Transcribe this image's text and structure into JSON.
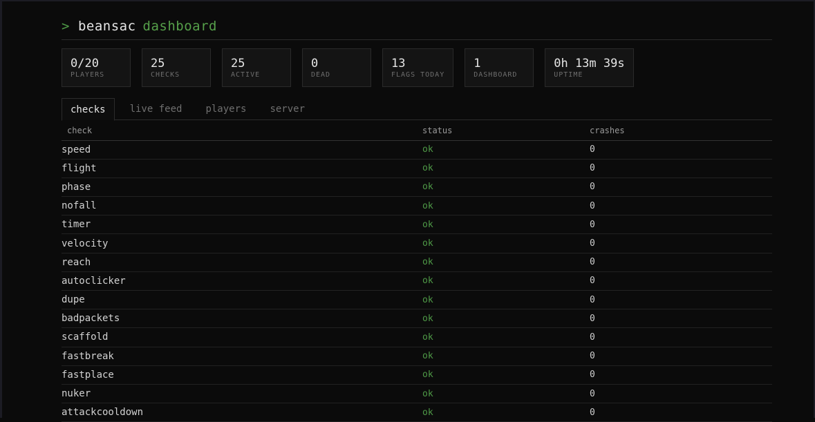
{
  "header": {
    "prompt": ">",
    "name": "beansac",
    "subtitle": "dashboard"
  },
  "stats": [
    {
      "value": "0/20",
      "label": "PLAYERS"
    },
    {
      "value": "25",
      "label": "CHECKS"
    },
    {
      "value": "25",
      "label": "ACTIVE"
    },
    {
      "value": "0",
      "label": "DEAD"
    },
    {
      "value": "13",
      "label": "FLAGS TODAY"
    },
    {
      "value": "1",
      "label": "DASHBOARD"
    },
    {
      "value": "0h 13m 39s",
      "label": "UPTIME"
    }
  ],
  "tabs": [
    {
      "label": "checks",
      "active": true
    },
    {
      "label": "live feed",
      "active": false
    },
    {
      "label": "players",
      "active": false
    },
    {
      "label": "server",
      "active": false
    }
  ],
  "table": {
    "columns": [
      "check",
      "status",
      "crashes"
    ],
    "rows": [
      {
        "check": "speed",
        "status": "ok",
        "crashes": "0"
      },
      {
        "check": "flight",
        "status": "ok",
        "crashes": "0"
      },
      {
        "check": "phase",
        "status": "ok",
        "crashes": "0"
      },
      {
        "check": "nofall",
        "status": "ok",
        "crashes": "0"
      },
      {
        "check": "timer",
        "status": "ok",
        "crashes": "0"
      },
      {
        "check": "velocity",
        "status": "ok",
        "crashes": "0"
      },
      {
        "check": "reach",
        "status": "ok",
        "crashes": "0"
      },
      {
        "check": "autoclicker",
        "status": "ok",
        "crashes": "0"
      },
      {
        "check": "dupe",
        "status": "ok",
        "crashes": "0"
      },
      {
        "check": "badpackets",
        "status": "ok",
        "crashes": "0"
      },
      {
        "check": "scaffold",
        "status": "ok",
        "crashes": "0"
      },
      {
        "check": "fastbreak",
        "status": "ok",
        "crashes": "0"
      },
      {
        "check": "fastplace",
        "status": "ok",
        "crashes": "0"
      },
      {
        "check": "nuker",
        "status": "ok",
        "crashes": "0"
      },
      {
        "check": "attackcooldown",
        "status": "ok",
        "crashes": "0"
      }
    ]
  },
  "colors": {
    "accent": "#4f9a47",
    "background": "#0b0b0b"
  }
}
